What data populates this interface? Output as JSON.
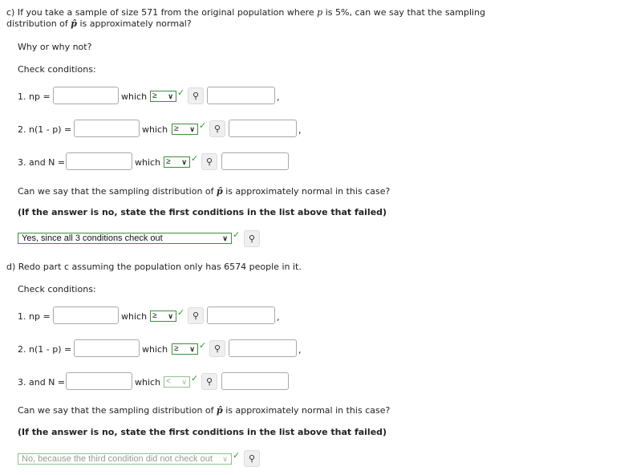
{
  "part_c": {
    "question_line1_pre": "c) If you take a sample of size 571 from the original population where ",
    "question_p": "p",
    "question_line1_post": " is 5%, can we say that the sampling",
    "question_line2_pre": "distribution of ",
    "question_phat": "p̂",
    "question_line2_post": " is approximately normal?",
    "why": "Why or why not?",
    "check_conditions": "Check conditions:",
    "conditions": [
      {
        "label": "1. np =",
        "input_value": "",
        "which": "which",
        "selected": "≥",
        "answer_value": "",
        "trailing": ","
      },
      {
        "label": "2. n(1 - p) =",
        "input_value": "",
        "which": "which",
        "selected": "≥",
        "answer_value": "",
        "trailing": ","
      },
      {
        "label": "3. and N =",
        "input_value": "",
        "which": "which",
        "selected": "≥",
        "answer_value": ""
      }
    ],
    "normal_question_pre": "Can we say that the sampling distribution of ",
    "normal_question_phat": "p̂",
    "normal_question_post": " is approximately normal in this case?",
    "instruction": "(If the answer is no, state the first conditions in the list above that failed)",
    "answer_selected": "Yes, since all 3 conditions check out"
  },
  "part_d": {
    "question": "d) Redo part c assuming the population only has 6574 people in it.",
    "check_conditions": "Check conditions:",
    "conditions": [
      {
        "label": "1. np =",
        "input_value": "",
        "which": "which",
        "selected": "≥",
        "answer_value": "",
        "trailing": ","
      },
      {
        "label": "2. n(1 - p) =",
        "input_value": "",
        "which": "which",
        "selected": "≥",
        "answer_value": "",
        "trailing": ","
      },
      {
        "label": "3. and N =",
        "input_value": "",
        "which": "which",
        "selected": "<",
        "answer_value": ""
      }
    ],
    "normal_question_pre": "Can we say that the sampling distribution of ",
    "normal_question_phat": "p̂",
    "normal_question_post": " is approximately normal in this case?",
    "instruction": "(If the answer is no, state the first conditions in the list above that failed)",
    "answer_selected": "No, because the third condition did not check out"
  },
  "icons": {
    "chevron": "∨",
    "check": "✓",
    "key": "⚲"
  },
  "colors": {
    "correct_green": "#2e9a2e",
    "select_border": "#3c8f3c"
  }
}
